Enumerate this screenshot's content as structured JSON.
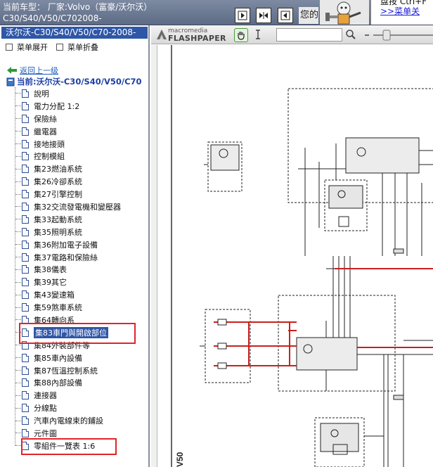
{
  "header": {
    "title": "当前车型： 厂家:Volvo（富豪/沃尔沃）C30/S40/V50/C702008-",
    "page_label": "您的",
    "tip_line1": "盘按 Ctrl+F",
    "tip_link": ">>菜单关"
  },
  "left_panel": {
    "title": "沃尔沃-C30/S40/V50/C70-2008-",
    "expand_label": "菜单展开",
    "collapse_label": "菜单折叠",
    "back_label": "返回上一级",
    "current_label": "当前:沃尔沃-C30/S40/V50/C70",
    "items": [
      {
        "label": "說明"
      },
      {
        "label": "電力分配 1:2"
      },
      {
        "label": "保險絲"
      },
      {
        "label": "繼電器"
      },
      {
        "label": "接地接頭"
      },
      {
        "label": "控制模組"
      },
      {
        "label": "集23燃油系統"
      },
      {
        "label": "集26冷卻系統"
      },
      {
        "label": "集27引擎控制"
      },
      {
        "label": "集32交流發電機和變壓器"
      },
      {
        "label": "集33起動系統"
      },
      {
        "label": "集35照明系統"
      },
      {
        "label": "集36附加電子設備"
      },
      {
        "label": "集37電路和保險絲"
      },
      {
        "label": "集38儀表"
      },
      {
        "label": "集39其它"
      },
      {
        "label": "集43變速箱"
      },
      {
        "label": "集59煞車系統"
      },
      {
        "label": "集64轉向系"
      },
      {
        "label": "集83車門與開啟部位",
        "selected": true
      },
      {
        "label": "集84外裝部件等"
      },
      {
        "label": "集85車內設備"
      },
      {
        "label": "集87恆溫控制系統"
      },
      {
        "label": "集88內部設備"
      },
      {
        "label": "連接器"
      },
      {
        "label": "分線點"
      },
      {
        "label": "汽車內電線束的鋪設"
      },
      {
        "label": "元件圖"
      },
      {
        "label": "零組件一覽表 1:6"
      }
    ]
  },
  "viewer": {
    "logo_small": "macromedia",
    "logo_big": "FLASHPAPER",
    "search_value": "",
    "diagram_labels": {
      "model": "V50"
    }
  },
  "colors": {
    "header_bg": "#6b7890",
    "selection": "#2f57a8",
    "highlight_box": "#e0242a",
    "wire_red": "#c8201e"
  }
}
